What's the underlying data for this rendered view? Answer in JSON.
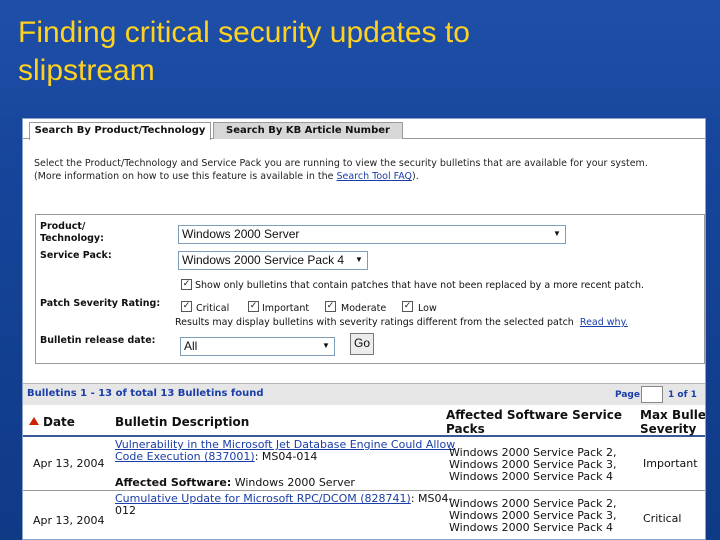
{
  "slide": {
    "title_line1": "Finding critical security updates to",
    "title_line2": "slipstream"
  },
  "tabs": [
    {
      "label": "Search By Product/Technology",
      "active": true
    },
    {
      "label": "Search By KB Article Number",
      "active": false
    }
  ],
  "intro": {
    "line1": "Select the Product/Technology and Service Pack you are running to view the security bulletins that are available for your system.",
    "line2_pre": "(More information on how to use this feature is available in the ",
    "line2_link": "Search Tool FAQ",
    "line2_post": ")."
  },
  "form": {
    "product_label_line1": "Product/",
    "product_label_line2": "Technology:",
    "product_value": "Windows 2000 Server",
    "sp_label": "Service Pack:",
    "sp_value": "Windows 2000 Service Pack 4",
    "show_only_label": "Show only bulletins that contain patches that have not been replaced by a more recent patch.",
    "severity_label": "Patch Severity Rating:",
    "severity_options": [
      "Critical",
      "Important",
      "Moderate",
      "Low"
    ],
    "severity_note": "Results may display bulletins with severity ratings different from the selected patch",
    "severity_note_link": "Read why.",
    "release_label": "Bulletin release date:",
    "release_value": "All",
    "go_label": "Go"
  },
  "results": {
    "count_text": "Bulletins 1 - 13 of total 13 Bulletins found",
    "page_label": "Page",
    "page_value": "",
    "page_of": "1 of 1",
    "columns": {
      "date": "Date",
      "description": "Bulletin Description",
      "affected_line1": "Affected Software Service",
      "affected_line2": "Packs",
      "severity_line1": "Max Bulle",
      "severity_line2": "Severity"
    },
    "rows": [
      {
        "date": "Apr 13, 2004",
        "title_line1": "Vulnerability in the Microsoft Jet Database Engine Could Allow",
        "title_line2": "Code Execution (837001)",
        "id": ": MS04-014",
        "affected_label": "Affected Software:",
        "affected_value": "Windows 2000 Server",
        "packs": [
          "Windows 2000 Service Pack 2,",
          "Windows 2000 Service Pack 3,",
          "Windows 2000 Service Pack 4"
        ],
        "severity": "Important"
      },
      {
        "date": "Apr 13, 2004",
        "title_line1": "Cumulative Update for Microsoft RPC/DCOM (828741)",
        "title_line1_tail": ": MS04-",
        "title_line2": "012",
        "packs": [
          "Windows 2000 Service Pack 2,",
          "Windows 2000 Service Pack 3,",
          "Windows 2000 Service Pack 4"
        ],
        "severity": "Critical"
      }
    ]
  }
}
